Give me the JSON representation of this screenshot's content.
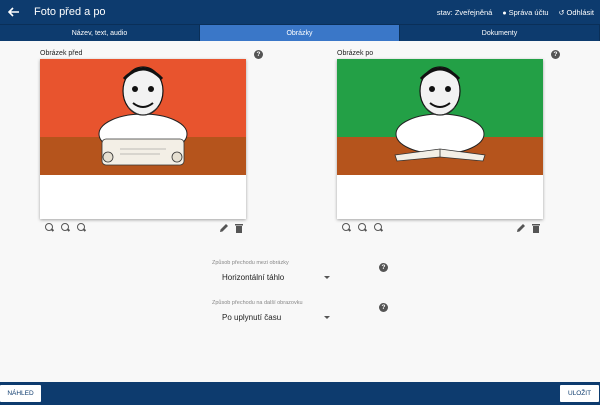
{
  "header": {
    "back_icon": "arrow-left-icon",
    "title": "Foto před a po",
    "status": "stav: Zveřejněná",
    "account": "Správa účtu",
    "logout": "Odhlásit"
  },
  "tabs": [
    {
      "label": "Název, text, audio",
      "active": false
    },
    {
      "label": "Obrázky",
      "active": true
    },
    {
      "label": "Dokumenty",
      "active": false
    }
  ],
  "images": {
    "before": {
      "label": "Obrázek před",
      "background": "#e8542e",
      "object": "scroll"
    },
    "after": {
      "label": "Obrázek po",
      "background": "#23a046",
      "object": "book"
    },
    "table_color": "#b5541c"
  },
  "settings": {
    "transition": {
      "label": "Způsob přechodu mezi obrázky",
      "value": "Horizontální táhlo"
    },
    "next_image": {
      "label": "Způsob přechodu na další obrazovku",
      "value": "Po uplynutí času"
    }
  },
  "footer": {
    "preview": "NÁHLED",
    "save": "ULOŽIT"
  },
  "colors": {
    "navy": "#0d3b6e",
    "tab_active": "#3a77c8"
  }
}
